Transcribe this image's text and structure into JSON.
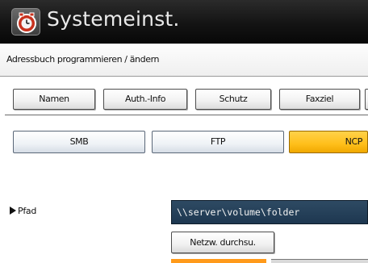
{
  "header": {
    "title": "Systemeinst.",
    "icon": "system-settings-icon"
  },
  "subheader": {
    "text": "Adressbuch programmieren / ändern"
  },
  "tabs": [
    {
      "label": "Namen"
    },
    {
      "label": "Auth.-Info"
    },
    {
      "label": "Schutz"
    },
    {
      "label": "Faxziel"
    }
  ],
  "protocols": [
    {
      "label": "SMB",
      "selected": false
    },
    {
      "label": "FTP",
      "selected": false
    },
    {
      "label": "NCP",
      "selected": true
    }
  ],
  "path": {
    "label": "Pfad",
    "value": "\\\\server\\volume\\folder"
  },
  "browse": {
    "label": "Netzw. durchsu."
  },
  "colors": {
    "selected_accent": "#ffbf1a",
    "input_background": "#23405a",
    "title_bar": "#141414"
  }
}
